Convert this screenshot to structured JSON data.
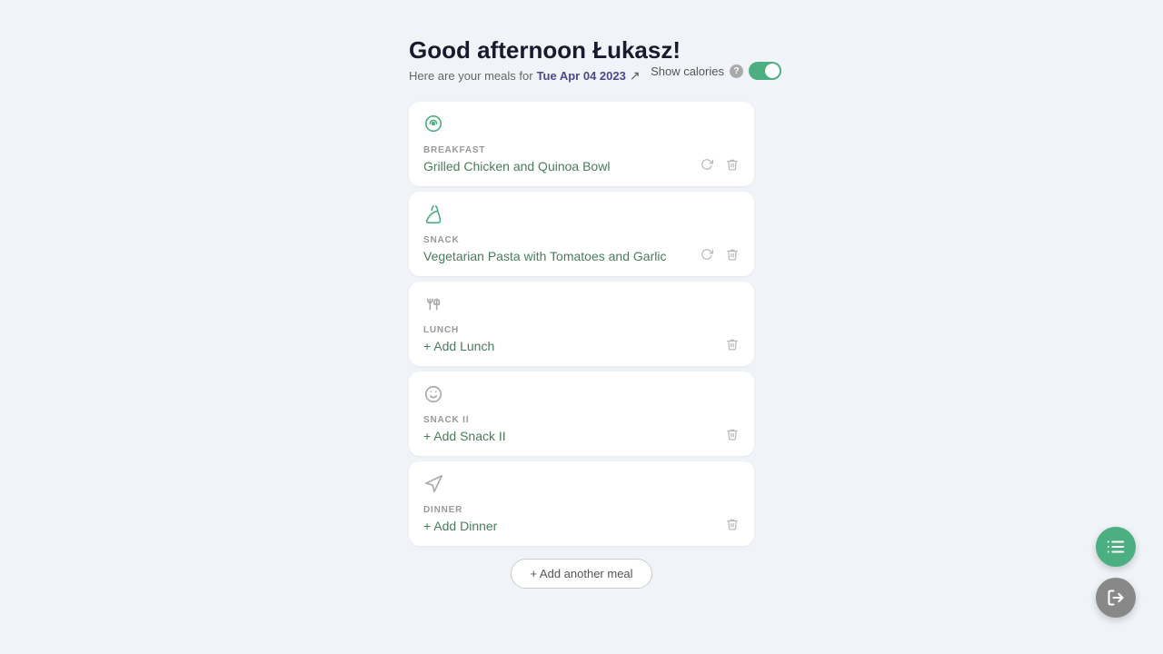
{
  "header": {
    "greeting": "Good afternoon Łukasz!",
    "subtitle_prefix": "Here are your meals for",
    "date": "Tue Apr 04 2023",
    "show_calories_label": "Show calories"
  },
  "toggle": {
    "enabled": true
  },
  "meals": [
    {
      "id": "breakfast",
      "type": "BREAKFAST",
      "name": "Grilled Chicken and Quinoa Bowl",
      "has_meal": true,
      "icon": "🍃",
      "show_refresh": true,
      "show_delete": true
    },
    {
      "id": "snack",
      "type": "SNACK",
      "name": "Vegetarian Pasta with Tomatoes and Garlic",
      "has_meal": true,
      "icon": "🍃",
      "show_refresh": true,
      "show_delete": true
    },
    {
      "id": "lunch",
      "type": "LUNCH",
      "name": "+ Add Lunch",
      "has_meal": false,
      "icon": "🍴",
      "show_refresh": false,
      "show_delete": true
    },
    {
      "id": "snack2",
      "type": "SNACK II",
      "name": "+ Add Snack II",
      "has_meal": false,
      "icon": "😊",
      "show_refresh": false,
      "show_delete": true
    },
    {
      "id": "dinner",
      "type": "DINNER",
      "name": "+ Add Dinner",
      "has_meal": false,
      "icon": "🍽",
      "show_refresh": false,
      "show_delete": true
    }
  ],
  "add_meal_button": "+ Add another meal",
  "fab_primary_icon": "📋",
  "fab_secondary_icon": "→"
}
